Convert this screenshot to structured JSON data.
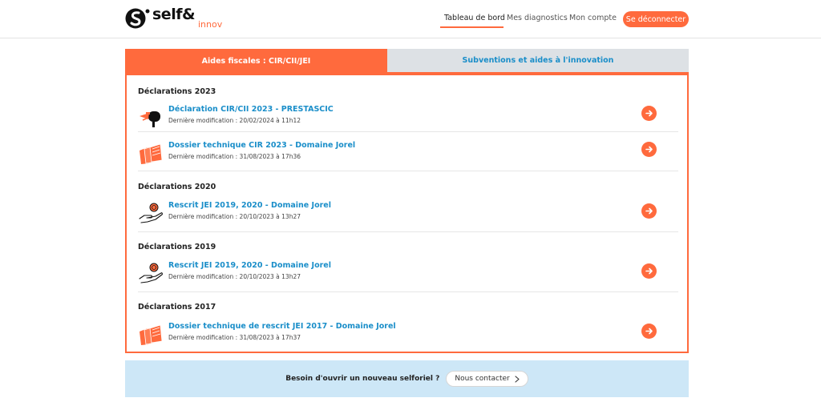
{
  "header": {
    "logo_main": "self&",
    "logo_sub": "innov",
    "nav": [
      {
        "label": "Tableau de bord",
        "active": true
      },
      {
        "label": "Mes diagnostics",
        "active": false
      },
      {
        "label": "Mon compte",
        "active": false
      }
    ],
    "logout_label": "Se déconnecter"
  },
  "tabs": [
    {
      "label": "Aides fiscales : CIR/CII/JEI",
      "active": true
    },
    {
      "label": "Subventions et aides à l'innovation",
      "active": false
    }
  ],
  "sections": [
    {
      "title": "Déclarations 2023",
      "items": [
        {
          "title": "Déclaration CIR/CII 2023 - PRESTASCIC",
          "meta": "Dernière modification : 20/02/2024 à 11h12",
          "icon": "mailbox-icon"
        },
        {
          "title": "Dossier technique CIR 2023 - Domaine Jorel",
          "meta": "Dernière modification : 31/08/2023 à 17h36",
          "icon": "folders-icon"
        }
      ]
    },
    {
      "title": "Déclarations 2020",
      "items": [
        {
          "title": "Rescrit JEI 2019, 2020 - Domaine Jorel",
          "meta": "Dernière modification : 20/10/2023 à 13h27",
          "icon": "hand-coin-icon"
        }
      ]
    },
    {
      "title": "Déclarations 2019",
      "items": [
        {
          "title": "Rescrit JEI 2019, 2020 - Domaine Jorel",
          "meta": "Dernière modification : 20/10/2023 à 13h27",
          "icon": "hand-coin-icon"
        }
      ]
    },
    {
      "title": "Déclarations 2017",
      "items": [
        {
          "title": "Dossier technique de rescrit JEI 2017 - Domaine Jorel",
          "meta": "Dernière modification : 31/08/2023 à 17h37",
          "icon": "folders-icon"
        }
      ]
    }
  ],
  "banner": {
    "text": "Besoin d'ouvrir un nouveau selforiel ?",
    "button_label": "Nous contacter"
  },
  "colors": {
    "accent": "#ff6a3d",
    "link": "#1a8ec9",
    "tab_inactive_bg": "#dde1e5",
    "banner_bg": "#cde7f7"
  }
}
